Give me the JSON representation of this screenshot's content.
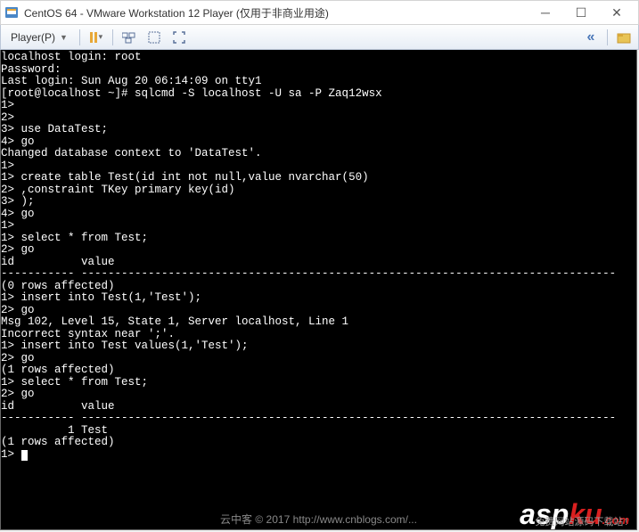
{
  "window": {
    "title": "CentOS 64 - VMware Workstation 12 Player (仅用于非商业用途)"
  },
  "toolbar": {
    "player_label": "Player(P)"
  },
  "terminal": {
    "lines": [
      "localhost login: root",
      "Password:",
      "Last login: Sun Aug 20 06:14:09 on tty1",
      "[root@localhost ~]# sqlcmd -S localhost -U sa -P Zaq12wsx",
      "1>",
      "2>",
      "3> use DataTest;",
      "4> go",
      "Changed database context to 'DataTest'.",
      "1>",
      "1> create table Test(id int not null,value nvarchar(50)",
      "2> ,constraint TKey primary key(id)",
      "3> );",
      "4> go",
      "1>",
      "1> select * from Test;",
      "2> go",
      "id          value",
      "----------- --------------------------------------------------------------------------------",
      "",
      "(0 rows affected)",
      "1> insert into Test(1,'Test');",
      "2> go",
      "Msg 102, Level 15, State 1, Server localhost, Line 1",
      "Incorrect syntax near ';'.",
      "1> insert into Test values(1,'Test');",
      "2> go",
      "",
      "(1 rows affected)",
      "1> select * from Test;",
      "2> go",
      "id          value",
      "----------- --------------------------------------------------------------------------------",
      "          1 Test",
      "",
      "(1 rows affected)",
      "1> "
    ]
  },
  "watermark": "云中客 © 2017 http://www.cnblogs.com/...",
  "logo": {
    "asp": "asp",
    "ku": "ku",
    "com": ".com",
    "sub": "免费网站源码下载站!"
  }
}
